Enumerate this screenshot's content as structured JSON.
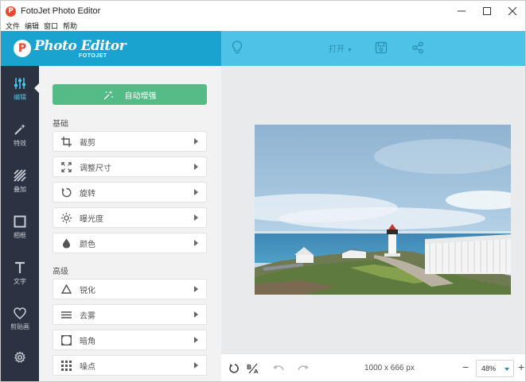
{
  "window": {
    "title": "FotoJet Photo Editor",
    "icon_letter": "P"
  },
  "menu": [
    "文件",
    "编辑",
    "窗口",
    "帮助"
  ],
  "logo": {
    "letter": "P",
    "title": "Photo Editor",
    "subtitle": "FOTOJET"
  },
  "toolbar": {
    "open_label": "打开"
  },
  "nav": [
    {
      "label": "编辑",
      "icon": "sliders-icon",
      "active": true
    },
    {
      "label": "特效",
      "icon": "magic-wand-icon"
    },
    {
      "label": "叠加",
      "icon": "stripes-icon"
    },
    {
      "label": "相框",
      "icon": "frame-icon"
    },
    {
      "label": "文字",
      "icon": "text-icon"
    },
    {
      "label": "剪贴画",
      "icon": "heart-icon"
    },
    {
      "label": "",
      "icon": "gear-icon"
    }
  ],
  "panel": {
    "auto_enhance": "自动增强",
    "basic_label": "基础",
    "basic_tools": [
      "裁剪",
      "调整尺寸",
      "旋转",
      "曝光度",
      "颜色"
    ],
    "advanced_label": "高级",
    "advanced_tools": [
      "锐化",
      "去雾",
      "暗角",
      "噪点"
    ]
  },
  "status": {
    "dimensions": "1000 x 666 px",
    "zoom": "48%"
  },
  "colors": {
    "accent": "#4ec3e7",
    "brand": "#1ba3cf",
    "enhance": "#54bb86",
    "nav_bg": "#2b3241"
  }
}
